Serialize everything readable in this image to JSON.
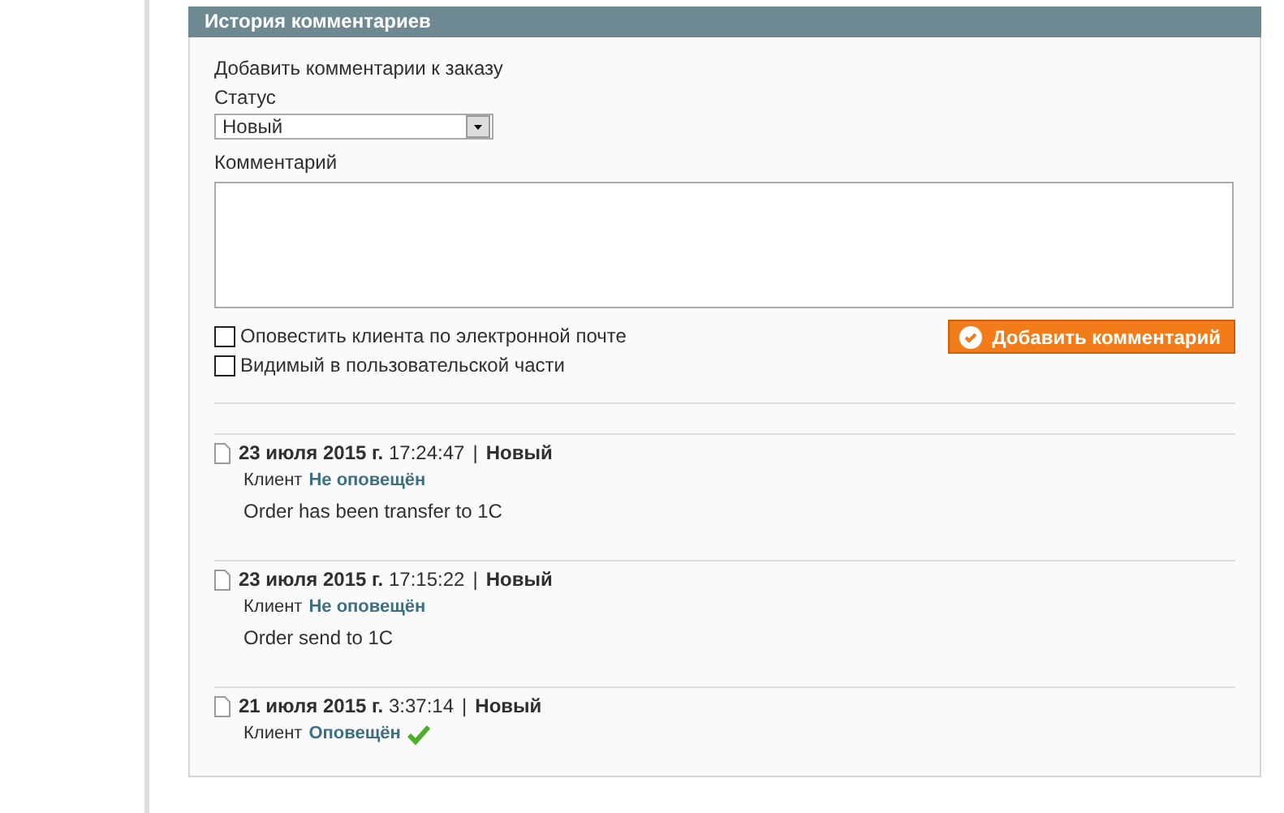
{
  "panel": {
    "title": "История комментариев"
  },
  "form": {
    "heading": "Добавить комментарии к заказу",
    "status_label": "Статус",
    "status_value": "Новый",
    "comment_label": "Комментарий",
    "checkboxes": [
      {
        "label": "Оповестить клиента по электронной почте",
        "checked": false
      },
      {
        "label": "Видимый в пользовательской части",
        "checked": false
      }
    ],
    "submit": "Добавить комментарий"
  },
  "history": [
    {
      "date": "23 июля 2015 г.",
      "time": "17:24:47",
      "separator": "|",
      "status": "Новый",
      "customer_label": "Клиент",
      "notified_text": "Не оповещён",
      "notified": false,
      "comment": "Order has been transfer to 1C"
    },
    {
      "date": "23 июля 2015 г.",
      "time": "17:15:22",
      "separator": "|",
      "status": "Новый",
      "customer_label": "Клиент",
      "notified_text": "Не оповещён",
      "notified": false,
      "comment": "Order send to 1C"
    },
    {
      "date": "21 июля 2015 г.",
      "time": "3:37:14",
      "separator": "|",
      "status": "Новый",
      "customer_label": "Клиент",
      "notified_text": "Оповещён",
      "notified": true
    }
  ]
}
